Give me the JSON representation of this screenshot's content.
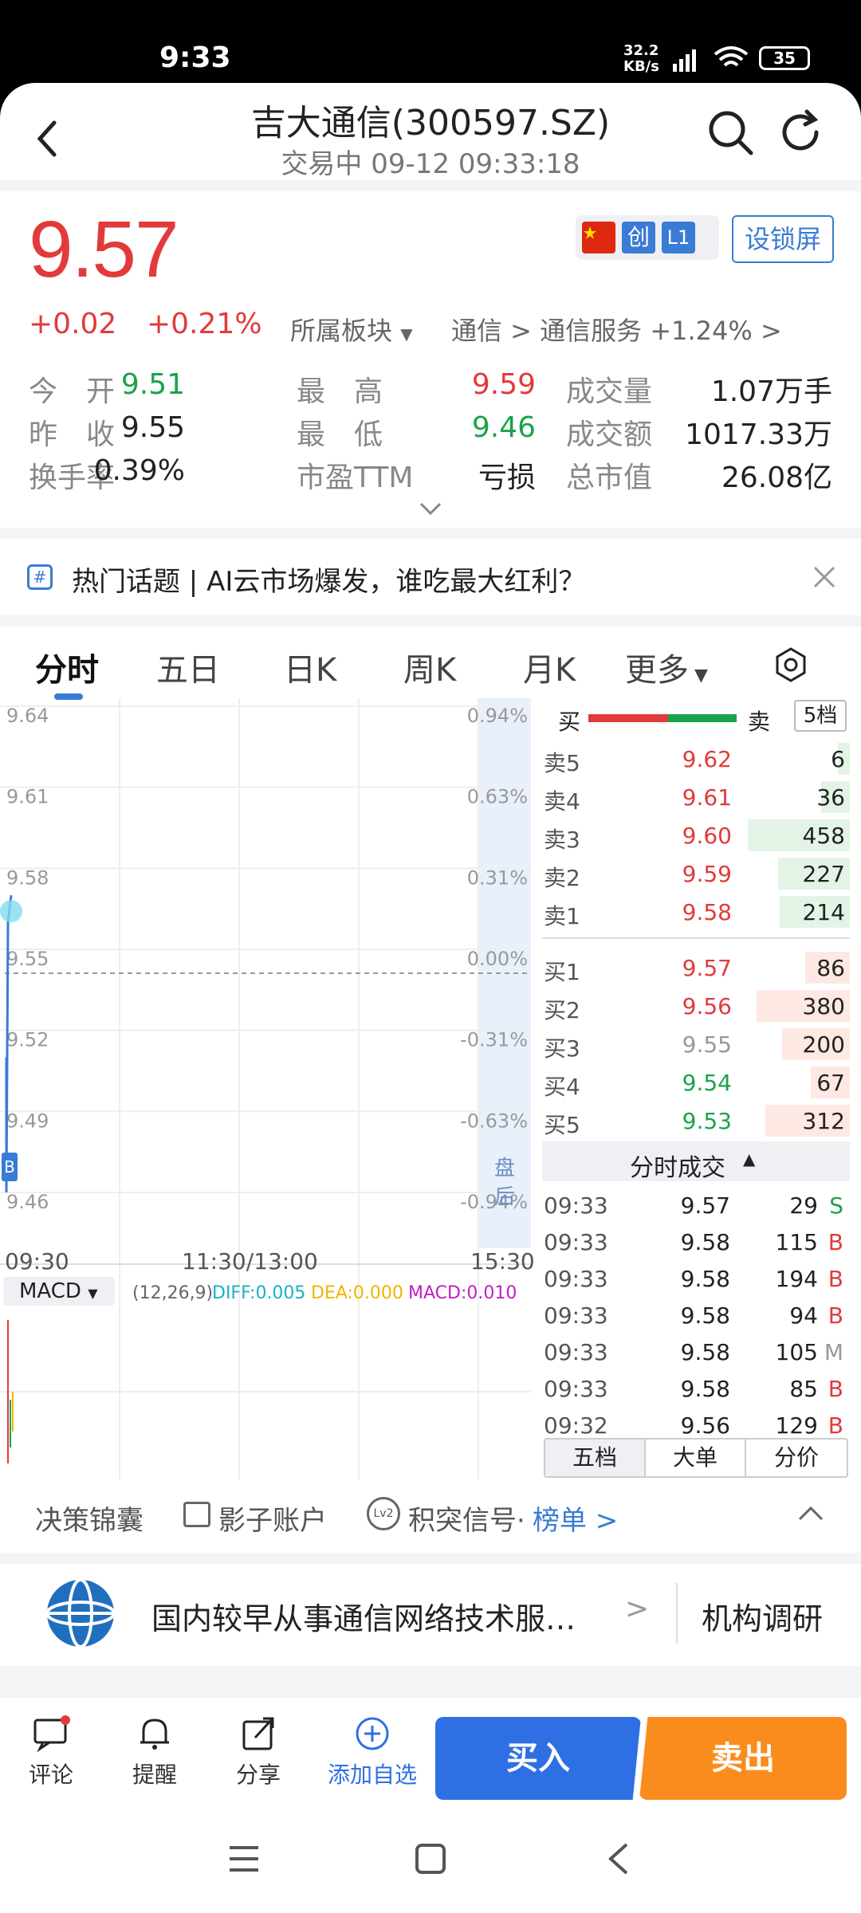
{
  "status_bar": {
    "time": "9:33",
    "net_speed_top": "32.2",
    "net_speed_bottom": "KB/s",
    "battery": "35"
  },
  "header": {
    "title": "吉大通信(300597.SZ)",
    "subtitle": "交易中 09-12 09:33:18"
  },
  "quote": {
    "price": "9.57",
    "change": "+0.02",
    "change_pct": "+0.21%",
    "sector_label": "所属板块",
    "sector_path": "通信 > 通信服务 +1.24% >",
    "badge_chuang": "创",
    "badge_l1": "L1",
    "lock_screen": "设锁屏"
  },
  "stats": [
    {
      "label": "今　开",
      "value": "9.51",
      "color": "green"
    },
    {
      "label": "最　高",
      "value": "9.59",
      "color": "red"
    },
    {
      "label": "成交量",
      "value": "1.07万手",
      "color": "blk"
    },
    {
      "label": "昨　收",
      "value": "9.55",
      "color": "blk"
    },
    {
      "label": "最　低",
      "value": "9.46",
      "color": "green"
    },
    {
      "label": "成交额",
      "value": "1017.33万",
      "color": "blk"
    },
    {
      "label": "换手率",
      "value": "0.39%",
      "color": "blk"
    },
    {
      "label": "市盈TTM",
      "value": "亏损",
      "color": "blk"
    },
    {
      "label": "总市值",
      "value": "26.08亿",
      "color": "blk"
    }
  ],
  "topic": {
    "text": "热门话题 | AI云市场爆发，谁吃最大红利？"
  },
  "tabs": [
    "分时",
    "五日",
    "日K",
    "周K",
    "月K",
    "更多"
  ],
  "chart": {
    "left_ticks": [
      "9.64",
      "9.61",
      "9.58",
      "9.55",
      "9.52",
      "9.49",
      "9.46"
    ],
    "right_ticks": [
      "0.94%",
      "0.63%",
      "0.31%",
      "0.00%",
      "-0.31%",
      "-0.63%",
      "-0.94%"
    ],
    "time_start": "09:30",
    "time_mid": "11:30/13:00",
    "time_end": "15:30",
    "after_hours": "盘后",
    "b_marker": "B",
    "macd": {
      "name": "MACD",
      "params": "(12,26,9)",
      "diff": "DIFF:0.005",
      "dea": "DEA:0.000",
      "macd": "MACD:0.010"
    }
  },
  "chart_data": {
    "type": "line",
    "title": "",
    "x": [
      "09:30",
      "09:31",
      "09:32",
      "09:33"
    ],
    "series": [
      {
        "values": [
          9.51,
          9.46,
          9.56,
          9.57
        ]
      }
    ],
    "ylim": [
      9.46,
      9.64
    ],
    "reference": 9.55
  },
  "orderbook": {
    "buy_label": "买",
    "sell_label": "卖",
    "levels_button": "5档",
    "asks": [
      {
        "label": "卖5",
        "price": "9.62",
        "vol": "6",
        "color": "red"
      },
      {
        "label": "卖4",
        "price": "9.61",
        "vol": "36",
        "color": "red"
      },
      {
        "label": "卖3",
        "price": "9.60",
        "vol": "458",
        "color": "red"
      },
      {
        "label": "卖2",
        "price": "9.59",
        "vol": "227",
        "color": "red"
      },
      {
        "label": "卖1",
        "price": "9.58",
        "vol": "214",
        "color": "red"
      }
    ],
    "bids": [
      {
        "label": "买1",
        "price": "9.57",
        "vol": "86",
        "color": "red"
      },
      {
        "label": "买2",
        "price": "9.56",
        "vol": "380",
        "color": "red"
      },
      {
        "label": "买3",
        "price": "9.55",
        "vol": "200",
        "color": "gray"
      },
      {
        "label": "买4",
        "price": "9.54",
        "vol": "67",
        "color": "green"
      },
      {
        "label": "买5",
        "price": "9.53",
        "vol": "312",
        "color": "green"
      }
    ],
    "trades_title": "分时成交",
    "trades": [
      {
        "time": "09:33",
        "price": "9.57",
        "vol": "29",
        "side": "S"
      },
      {
        "time": "09:33",
        "price": "9.58",
        "vol": "115",
        "side": "B"
      },
      {
        "time": "09:33",
        "price": "9.58",
        "vol": "194",
        "side": "B"
      },
      {
        "time": "09:33",
        "price": "9.58",
        "vol": "94",
        "side": "B"
      },
      {
        "time": "09:33",
        "price": "9.58",
        "vol": "105",
        "side": "M"
      },
      {
        "time": "09:33",
        "price": "9.58",
        "vol": "85",
        "side": "B"
      },
      {
        "time": "09:32",
        "price": "9.56",
        "vol": "129",
        "side": "B"
      }
    ],
    "subtabs": [
      "五档",
      "大单",
      "分价"
    ]
  },
  "tools": {
    "t1": "决策锦囊",
    "t2": "影子账户",
    "t3": "积突信号·",
    "t3_link": "榜单 >",
    "lv2": "Lv2"
  },
  "company": {
    "desc": "国内较早从事通信网络技术服…",
    "research": "机构调研"
  },
  "bottom": {
    "comment": "评论",
    "alert": "提醒",
    "share": "分享",
    "watch": "添加自选",
    "buy": "买入",
    "sell": "卖出"
  },
  "colors": {
    "red": "#e23a3a",
    "green": "#1aa34a",
    "blue": "#2f6fe4",
    "orange": "#fa8c1e"
  }
}
